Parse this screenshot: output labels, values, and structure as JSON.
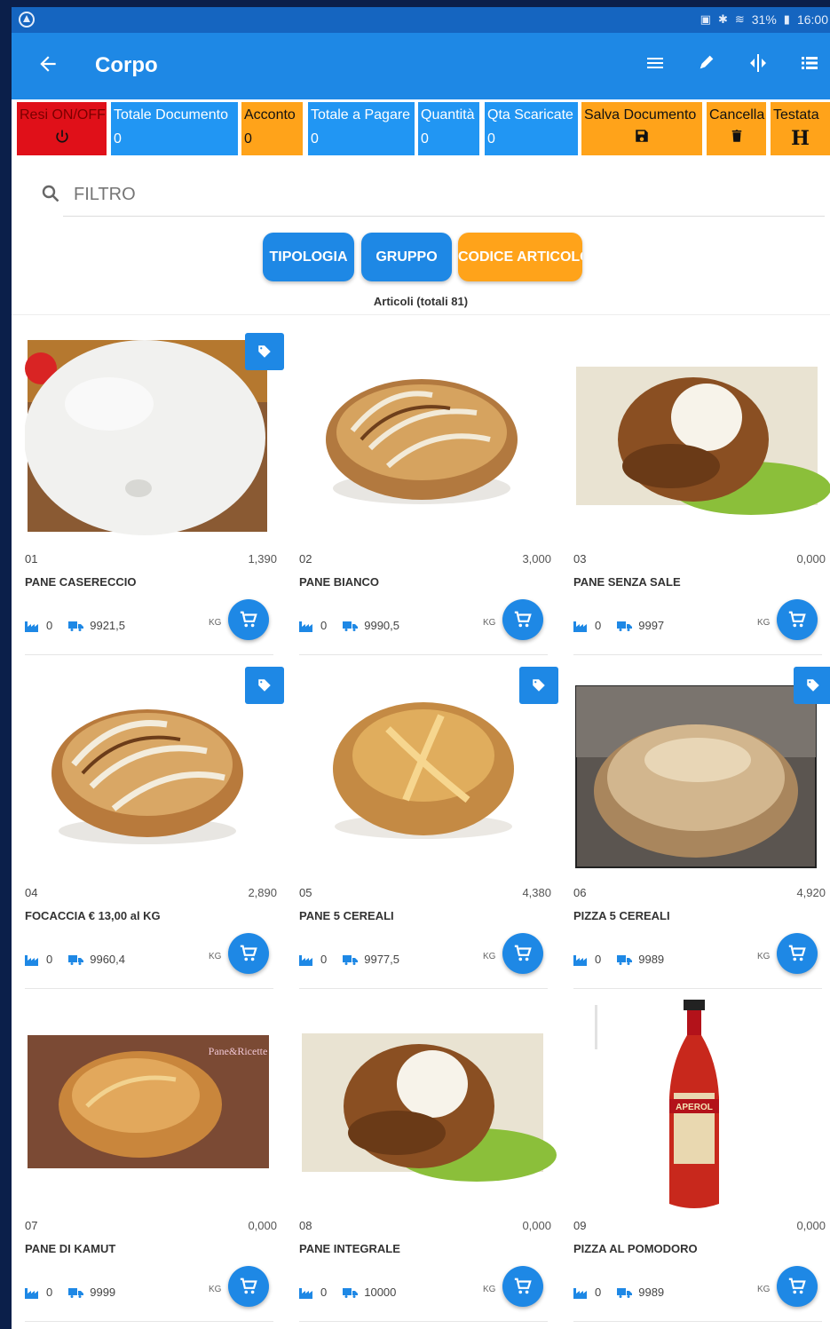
{
  "status": {
    "signal": "31%",
    "time": "16:00"
  },
  "appbar": {
    "title": "Corpo"
  },
  "toolbar": [
    {
      "label": "Resi ON/OFF",
      "icon": "power-icon"
    },
    {
      "label": "Totale Documento",
      "value": "0"
    },
    {
      "label": "Acconto",
      "value": "0"
    },
    {
      "label": "Totale a Pagare",
      "value": "0"
    },
    {
      "label": "Quantità",
      "value": "0"
    },
    {
      "label": "Qta Scaricate",
      "value": "0"
    },
    {
      "label": "Salva Documento",
      "icon": "save-icon"
    },
    {
      "label": "Cancella",
      "icon": "trash-icon"
    },
    {
      "label": "Testata",
      "icon_text": "H"
    }
  ],
  "filter": {
    "placeholder": "FILTRO"
  },
  "chips": [
    "TIPOLOGIA",
    "GRUPPO",
    "CODICE ARTICOLO"
  ],
  "count_label": "Articoli (totali 81)",
  "colors": {
    "primary": "#1e88e5",
    "orange": "#ffa31a",
    "red": "#e01019",
    "bg": "#0b1f4a"
  },
  "products": [
    {
      "code": "01",
      "name": "PANE CASERECCIO",
      "price": "1,390",
      "stock": "0",
      "ordered": "9921,5",
      "unit": "KG",
      "tag": true
    },
    {
      "code": "02",
      "name": "PANE BIANCO",
      "price": "3,000",
      "stock": "0",
      "ordered": "9990,5",
      "unit": "KG",
      "tag": false
    },
    {
      "code": "03",
      "name": "PANE SENZA SALE",
      "price": "0,000",
      "stock": "0",
      "ordered": "9997",
      "unit": "KG",
      "tag": false
    },
    {
      "code": "04",
      "name": "FOCACCIA € 13,00 al KG",
      "price": "2,890",
      "stock": "0",
      "ordered": "9960,4",
      "unit": "KG",
      "tag": true
    },
    {
      "code": "05",
      "name": "PANE 5 CEREALI",
      "price": "4,380",
      "stock": "0",
      "ordered": "9977,5",
      "unit": "KG",
      "tag": true
    },
    {
      "code": "06",
      "name": "PIZZA 5 CEREALI",
      "price": "4,920",
      "stock": "0",
      "ordered": "9989",
      "unit": "KG",
      "tag": true
    },
    {
      "code": "07",
      "name": "PANE DI KAMUT",
      "price": "0,000",
      "stock": "0",
      "ordered": "9999",
      "unit": "KG",
      "tag": false,
      "watermark": "Pane&Ricette"
    },
    {
      "code": "08",
      "name": "PANE INTEGRALE",
      "price": "0,000",
      "stock": "0",
      "ordered": "10000",
      "unit": "KG",
      "tag": false
    },
    {
      "code": "09",
      "name": "PIZZA AL POMODORO",
      "price": "0,000",
      "stock": "0",
      "ordered": "9989",
      "unit": "KG",
      "tag": false,
      "bottle_label": "APEROL"
    }
  ]
}
